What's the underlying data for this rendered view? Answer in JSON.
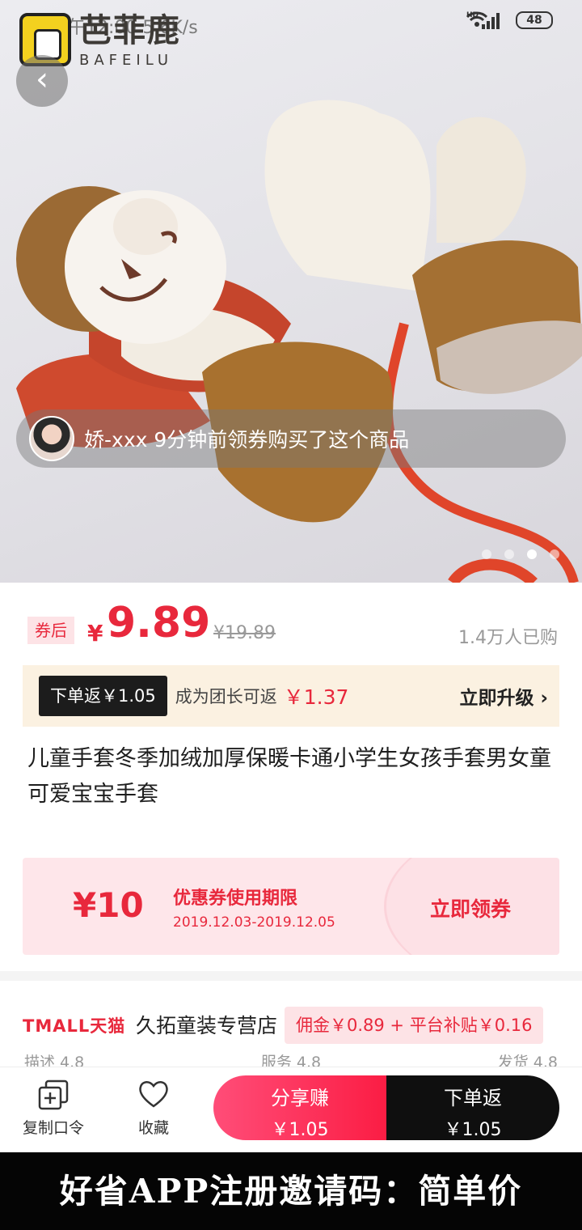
{
  "status_bar": {
    "time": "中午12:00 5.6K/s",
    "battery": "48",
    "network": "HD"
  },
  "brand": {
    "name_cn": "芭菲鹿",
    "name_en": "BAFEILU"
  },
  "hero": {
    "buyer_notice": "娇-xxx 9分钟前领券购买了这个商品",
    "carousel_count": 4,
    "carousel_active_index": 2
  },
  "price_info": {
    "coupon_tag": "券后",
    "currency": "¥",
    "price": "9.89",
    "original_price": "¥19.89",
    "sold_count": "1.4万人已购"
  },
  "rebate": {
    "order_rebate": "下单返￥1.05",
    "leader_text": "成为团长可返",
    "leader_amount": "￥1.37",
    "upgrade_label": "立即升级"
  },
  "product_title": "儿童手套冬季加绒加厚保暖卡通小学生女孩手套男女童可爱宝宝手套",
  "coupon": {
    "amount": "¥10",
    "label": "优惠券使用期限",
    "validity": "2019.12.03-2019.12.05",
    "claim_label": "立即领券"
  },
  "shop": {
    "platform": "TMALL天猫",
    "name": "久拓童装专营店",
    "commission": "佣金￥0.89 + 平台补贴￥0.16",
    "ratings": [
      "描述 4.8",
      "服务 4.8",
      "发货 4.8"
    ]
  },
  "bottom_bar": {
    "copy_label": "复制口令",
    "favorite_label": "收藏",
    "share_label": "分享赚",
    "share_amount": "￥1.05",
    "order_label": "下单返",
    "order_amount": "￥1.05"
  },
  "banner": "好省APP注册邀请码：简单价",
  "colors": {
    "accent": "#e8283c",
    "dark": "#0f0f0f",
    "cream": "#fbf1e1"
  }
}
